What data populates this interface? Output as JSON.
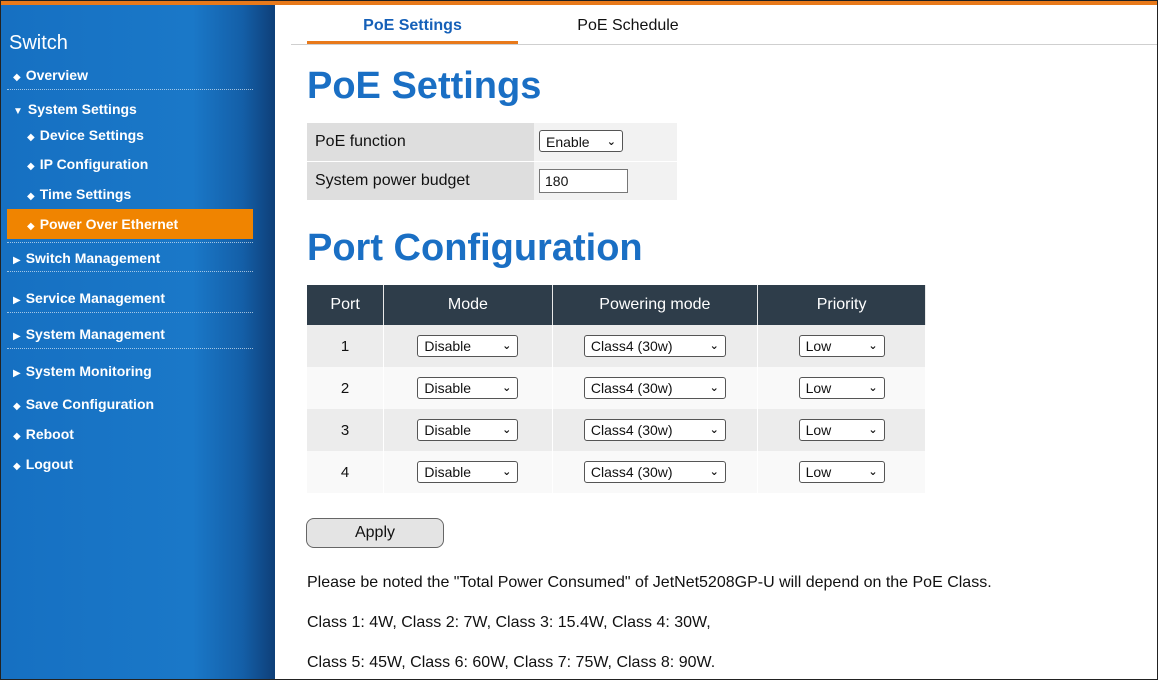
{
  "sidebar": {
    "title": "Switch",
    "items": [
      {
        "label": "Overview"
      },
      {
        "label": "System Settings"
      },
      {
        "label": "Device Settings"
      },
      {
        "label": "IP Configuration"
      },
      {
        "label": "Time Settings"
      },
      {
        "label": "Power Over Ethernet"
      },
      {
        "label": "Switch Management"
      },
      {
        "label": "Service Management"
      },
      {
        "label": "System Management"
      },
      {
        "label": "System Monitoring"
      },
      {
        "label": "Save Configuration"
      },
      {
        "label": "Reboot"
      },
      {
        "label": "Logout"
      }
    ],
    "active": "Power Over Ethernet"
  },
  "tabs": [
    {
      "label": "PoE Settings",
      "active": true
    },
    {
      "label": "PoE Schedule",
      "active": false
    }
  ],
  "poe_settings": {
    "heading": "PoE Settings",
    "function_label": "PoE function",
    "function_value": "Enable",
    "budget_label": "System power budget",
    "budget_value": "180"
  },
  "port_config": {
    "heading": "Port Configuration",
    "headers": [
      "Port",
      "Mode",
      "Powering mode",
      "Priority"
    ],
    "rows": [
      {
        "port": "1",
        "mode": "Disable",
        "powering": "Class4 (30w)",
        "priority": "Low"
      },
      {
        "port": "2",
        "mode": "Disable",
        "powering": "Class4 (30w)",
        "priority": "Low"
      },
      {
        "port": "3",
        "mode": "Disable",
        "powering": "Class4 (30w)",
        "priority": "Low"
      },
      {
        "port": "4",
        "mode": "Disable",
        "powering": "Class4 (30w)",
        "priority": "Low"
      }
    ]
  },
  "apply_label": "Apply",
  "notes": [
    "Please be noted the \"Total Power Consumed\" of JetNet5208GP-U will depend on the PoE Class.",
    "Class 1: 4W, Class 2: 7W, Class 3: 15.4W, Class 4: 30W,",
    "Class 5: 45W, Class 6: 60W, Class 7: 75W, Class 8: 90W."
  ],
  "colors": {
    "accent": "#e8791a",
    "sidebar_blue": "#1a78c8",
    "heading_blue": "#1a6fc4",
    "table_header": "#2e3d4a"
  }
}
